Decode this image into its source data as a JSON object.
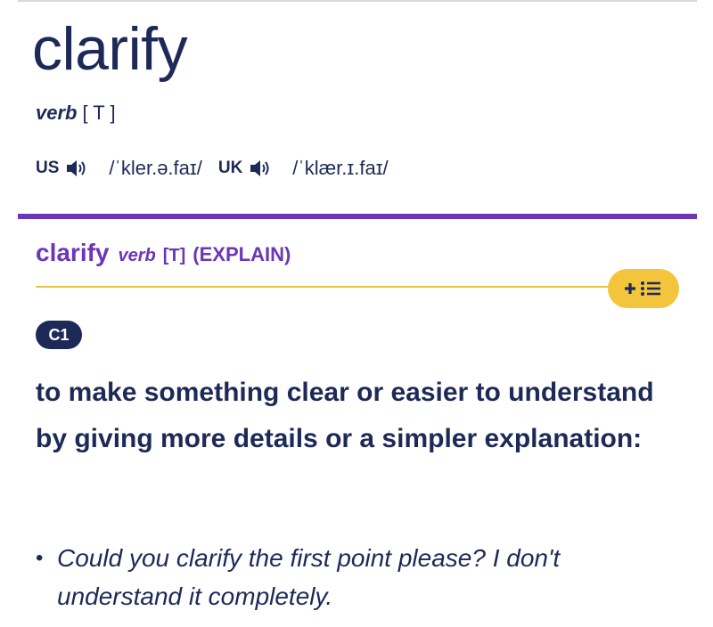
{
  "entry": {
    "headword": "clarify",
    "part_of_speech": "verb",
    "grammar": "[ T ]",
    "pronunciations": [
      {
        "region": "US",
        "ipa": "/ˈkler.ə.faɪ/"
      },
      {
        "region": "UK",
        "ipa": "/ˈklær.ɪ.faɪ/"
      }
    ]
  },
  "sense": {
    "headword": "clarify",
    "part_of_speech": "verb",
    "grammar": "[T]",
    "guideword": "(EXPLAIN)",
    "level": "C1",
    "definition": "to make something clear or easier to understand by giving more details or a simpler explanation:",
    "examples": [
      "Could you clarify the first point please? I don't understand it completely."
    ]
  },
  "icons": {
    "speaker": "speaker-icon",
    "wordlist": "add-to-wordlist-icon"
  },
  "colors": {
    "text": "#1d2a57",
    "accent_purple": "#6b36b8",
    "accent_gold": "#f2c53d",
    "badge_bg": "#1d2a57"
  }
}
